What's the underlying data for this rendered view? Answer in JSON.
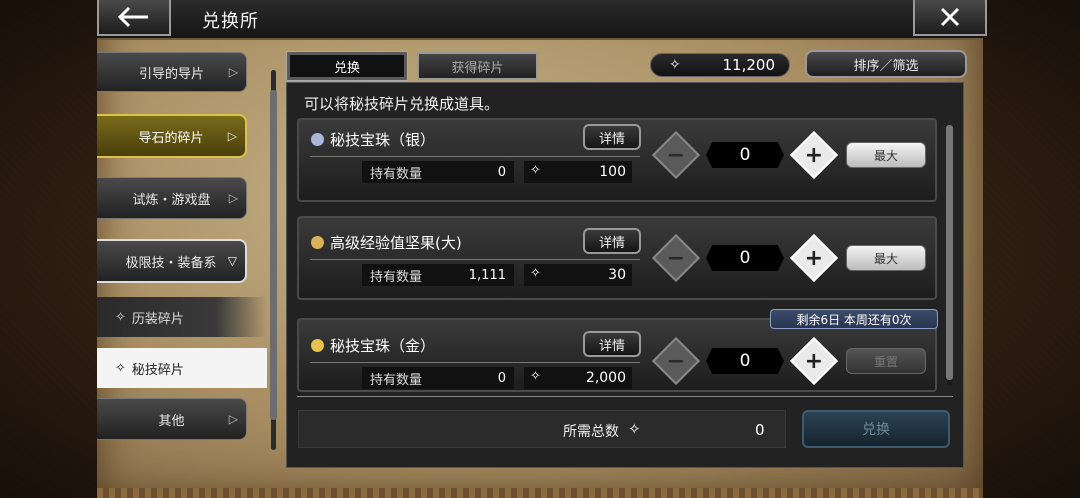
{
  "header": {
    "title": "兑换所"
  },
  "menu": {
    "items": [
      {
        "label": "引导的导片"
      },
      {
        "label": "导石的碎片"
      },
      {
        "label": "试炼・游戏盘"
      },
      {
        "label": "极限技・装备系"
      },
      {
        "label": "历装碎片"
      },
      {
        "label": "秘技碎片"
      },
      {
        "label": "其他"
      }
    ]
  },
  "tabs": [
    {
      "label": "兑换"
    },
    {
      "label": "获得碎片"
    }
  ],
  "currency": {
    "amount": "11,200",
    "icon": "diamond-icon"
  },
  "sort_label": "排序／筛选",
  "description": "可以将秘技碎片兑换成道具。",
  "items": [
    {
      "name": "秘技宝珠（银）",
      "detail": "详情",
      "own_label": "持有数量",
      "own": "0",
      "cost": "100",
      "qty": "0",
      "max": "最大",
      "icon_color": "#a9b8d8"
    },
    {
      "name": "高级经验值坚果(大)",
      "detail": "详情",
      "own_label": "持有数量",
      "own": "1,111",
      "cost": "30",
      "qty": "0",
      "max": "最大",
      "icon_color": "#d9b25a"
    },
    {
      "name": "秘技宝珠（金）",
      "detail": "详情",
      "own_label": "持有数量",
      "own": "0",
      "cost": "2,000",
      "qty": "0",
      "max": "重置",
      "icon_color": "#e8c24a"
    }
  ],
  "limit_badge": "剩余6日  本周还有0次",
  "footer": {
    "total_label": "所需总数",
    "total_value": "0",
    "exchange_label": "兑换"
  }
}
